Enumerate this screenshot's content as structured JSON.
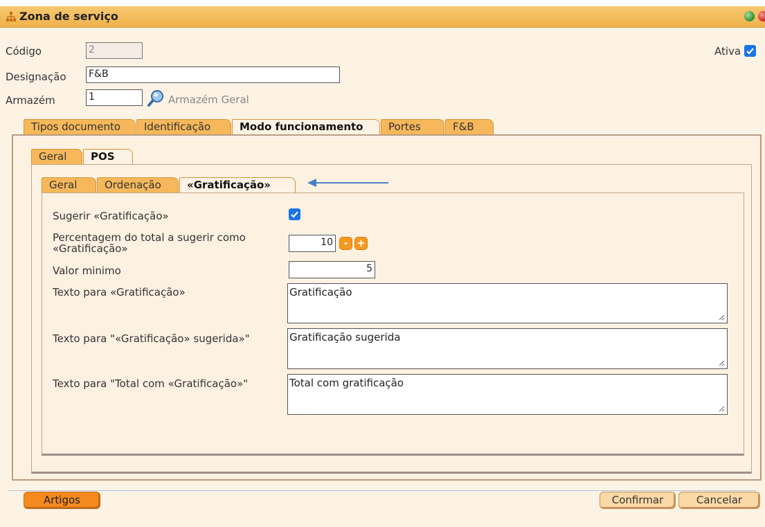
{
  "window": {
    "title": "Zona de serviço"
  },
  "header": {
    "codigo_label": "Código",
    "codigo_value": "2",
    "ativa_label": "Ativa",
    "ativa_checked": true,
    "designacao_label": "Designação",
    "designacao_value": "F&B",
    "armazem_label": "Armazém",
    "armazem_value": "1",
    "armazem_name": "Armazém Geral"
  },
  "main_tabs": [
    "Tipos documento",
    "Identificação",
    "Modo funcionamento",
    "Portes",
    "F&B"
  ],
  "main_tab_active": "Modo funcionamento",
  "sub_tabs": [
    "Geral",
    "POS"
  ],
  "sub_tab_active": "POS",
  "pos_tabs": [
    "Geral",
    "Ordenação",
    "«Gratificação»"
  ],
  "pos_tab_active": "«Gratificação»",
  "form": {
    "sugerir_label": "Sugerir «Gratificação»",
    "sugerir_checked": true,
    "percentagem_label_1": "Percentagem do total a sugerir como",
    "percentagem_label_2": "«Gratificação»",
    "percentagem_value": "10",
    "minus": "-",
    "plus": "+",
    "valor_minimo_label": "Valor minimo",
    "valor_minimo_value": "5",
    "texto_label": "Texto para «Gratificação»",
    "texto_value": "Gratificação",
    "texto_sugerida_label": "Texto para \"«Gratificação» sugerida»\"",
    "texto_sugerida_value": "Gratificação sugerida",
    "texto_total_label": "Texto para \"Total com «Gratificação»\"",
    "texto_total_value": "Total com gratificação"
  },
  "footer": {
    "artigos": "Artigos",
    "confirmar": "Confirmar",
    "cancelar": "Cancelar"
  },
  "colors": {
    "accent": "#f39a1f",
    "tab": "#f6b85a",
    "panel": "#fdf1e2",
    "checkbox": "#1a73e8",
    "arrow": "#4a7fc4"
  },
  "icons": [
    "network-icon",
    "magnifier-icon",
    "checkbox-check-icon",
    "resize-grip-icon",
    "arrow-left-icon"
  ]
}
